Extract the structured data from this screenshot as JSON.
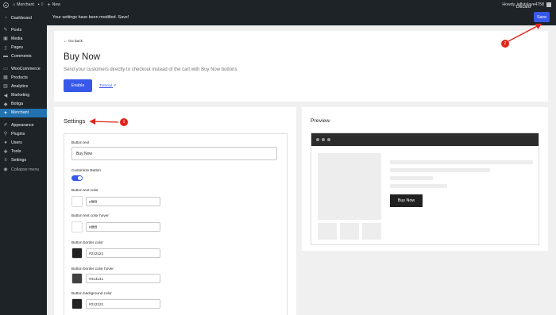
{
  "admin_bar": {
    "site_name": "Merchant",
    "comments_count": "0",
    "new_label": "New",
    "greeting": "Howdy, laflstslaye4758"
  },
  "sidebar": {
    "items": [
      {
        "label": "Dashboard",
        "icon": "dashboard-icon"
      },
      {
        "label": "Posts",
        "icon": "pin-icon"
      },
      {
        "label": "Media",
        "icon": "media-icon"
      },
      {
        "label": "Pages",
        "icon": "page-icon"
      },
      {
        "label": "Comments",
        "icon": "comment-icon"
      },
      {
        "label": "WooCommerce",
        "icon": "woocommerce-icon"
      },
      {
        "label": "Products",
        "icon": "box-icon"
      },
      {
        "label": "Analytics",
        "icon": "chart-icon"
      },
      {
        "label": "Marketing",
        "icon": "megaphone-icon"
      },
      {
        "label": "Botiga",
        "icon": "palette-icon"
      },
      {
        "label": "Merchant",
        "icon": "merchant-icon"
      },
      {
        "label": "Appearance",
        "icon": "brush-icon"
      },
      {
        "label": "Plugins",
        "icon": "plug-icon"
      },
      {
        "label": "Users",
        "icon": "user-icon"
      },
      {
        "label": "Tools",
        "icon": "wrench-icon"
      },
      {
        "label": "Settings",
        "icon": "sliders-icon"
      },
      {
        "label": "Collapse menu",
        "icon": "collapse-icon"
      }
    ]
  },
  "notice": {
    "message": "Your settings have been modified. Save!",
    "discard_label": "Discard",
    "save_label": "Save"
  },
  "header": {
    "back_label": "Go back",
    "title": "Buy Now",
    "description": "Send your customers directly to checkout instead of the cart with Buy Now buttons",
    "enable_label": "Enable",
    "tutorial_label": "Tutorial"
  },
  "settings": {
    "title": "Settings",
    "button_text_label": "Button text",
    "button_text_value": "Buy Now",
    "customize_label": "Customize Button",
    "customize_enabled": true,
    "colors": [
      {
        "label": "Button text color",
        "value": "#ffffff",
        "swatch": "#ffffff"
      },
      {
        "label": "Button text color hover",
        "value": "#ffffff",
        "swatch": "#ffffff"
      },
      {
        "label": "Button border color",
        "value": "#212121",
        "swatch": "#212121"
      },
      {
        "label": "Button border color hover",
        "value": "#414141",
        "swatch": "#414141"
      },
      {
        "label": "Button background color",
        "value": "#212121",
        "swatch": "#212121"
      }
    ]
  },
  "preview": {
    "title": "Preview",
    "button_label": "Buy Now"
  },
  "annotations": {
    "badge_1": "1",
    "badge_2": "2",
    "color": "#e2231a"
  },
  "colors": {
    "accent": "#3858e9",
    "admin_dark": "#1d2327",
    "active_menu": "#2271b1"
  }
}
